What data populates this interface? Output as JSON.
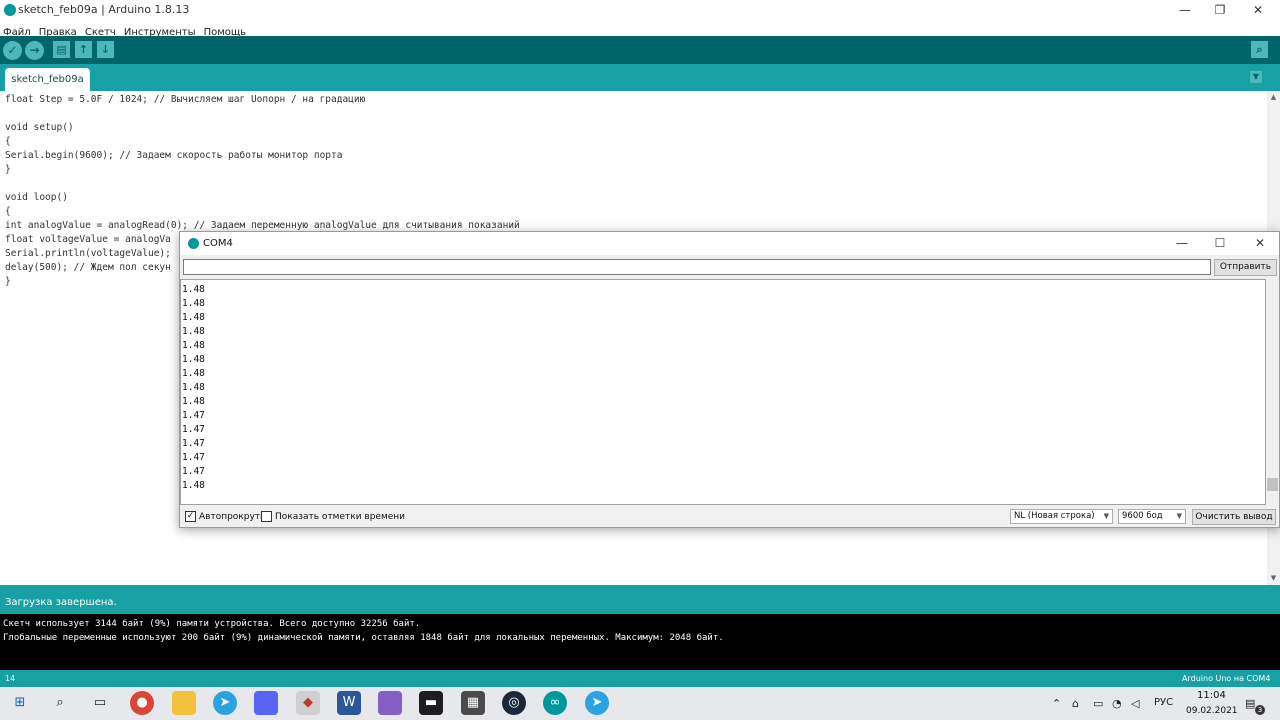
{
  "window": {
    "title": "sketch_feb09a | Arduino 1.8.13",
    "minimize": "—",
    "maximize": "❐",
    "close": "✕"
  },
  "menu": [
    "Файл",
    "Правка",
    "Скетч",
    "Инструменты",
    "Помощь"
  ],
  "toolbar": {
    "verify_icon": "✓",
    "upload_icon": "→",
    "new_icon": "▤",
    "open_icon": "↑",
    "save_icon": "↓",
    "serial_icon": "⌕"
  },
  "tab": {
    "label": "sketch_feb09a",
    "menu_icon": "▼"
  },
  "code": [
    "float Step = 5.0F / 1024; // Вычисляем шаг Uопорн / на градацию",
    "",
    "void setup()",
    "{",
    "Serial.begin(9600); // Задаем скорость работы монитор порта",
    "}",
    "",
    "void loop()",
    "{",
    "int analogValue = analogRead(0); // Задаем переменную analogValue для считывания показаний",
    "float voltageValue = analogVa",
    "Serial.println(voltageValue);",
    "delay(500); // Ждем пол секун",
    "}"
  ],
  "status": {
    "message": "Загрузка завершена."
  },
  "console": [
    "Скетч использует 3144 байт (9%) памяти устройства. Всего доступно 32256 байт.",
    "Глобальные переменные используют 200 байт (9%) динамической памяти, оставляя 1848 байт для локальных переменных. Максимум: 2048 байт."
  ],
  "footer": {
    "line_number": "14",
    "board": "Arduino Uno на COM4"
  },
  "serial_monitor": {
    "title": "COM4",
    "input_value": "",
    "send_label": "Отправить",
    "output": [
      "1.48",
      "1.48",
      "1.48",
      "1.48",
      "1.48",
      "1.48",
      "1.48",
      "1.48",
      "1.48",
      "1.47",
      "1.47",
      "1.47",
      "1.47",
      "1.47",
      "1.48"
    ],
    "autoscroll_label": "Автопрокрутка",
    "autoscroll_checked": true,
    "timestamps_label": "Показать отметки времени",
    "timestamps_checked": false,
    "line_ending": "NL (Новая строка)",
    "baud": "9600 бод",
    "clear_label": "Очистить вывод"
  },
  "taskbar": {
    "tray_lang": "РУС",
    "time": "11:04",
    "date": "09.02.2021",
    "notification_count": "3"
  },
  "colors": {
    "arduino_teal": "#00979d",
    "toolbar_dark": "#006468",
    "tab_bar": "#17a1a5"
  }
}
